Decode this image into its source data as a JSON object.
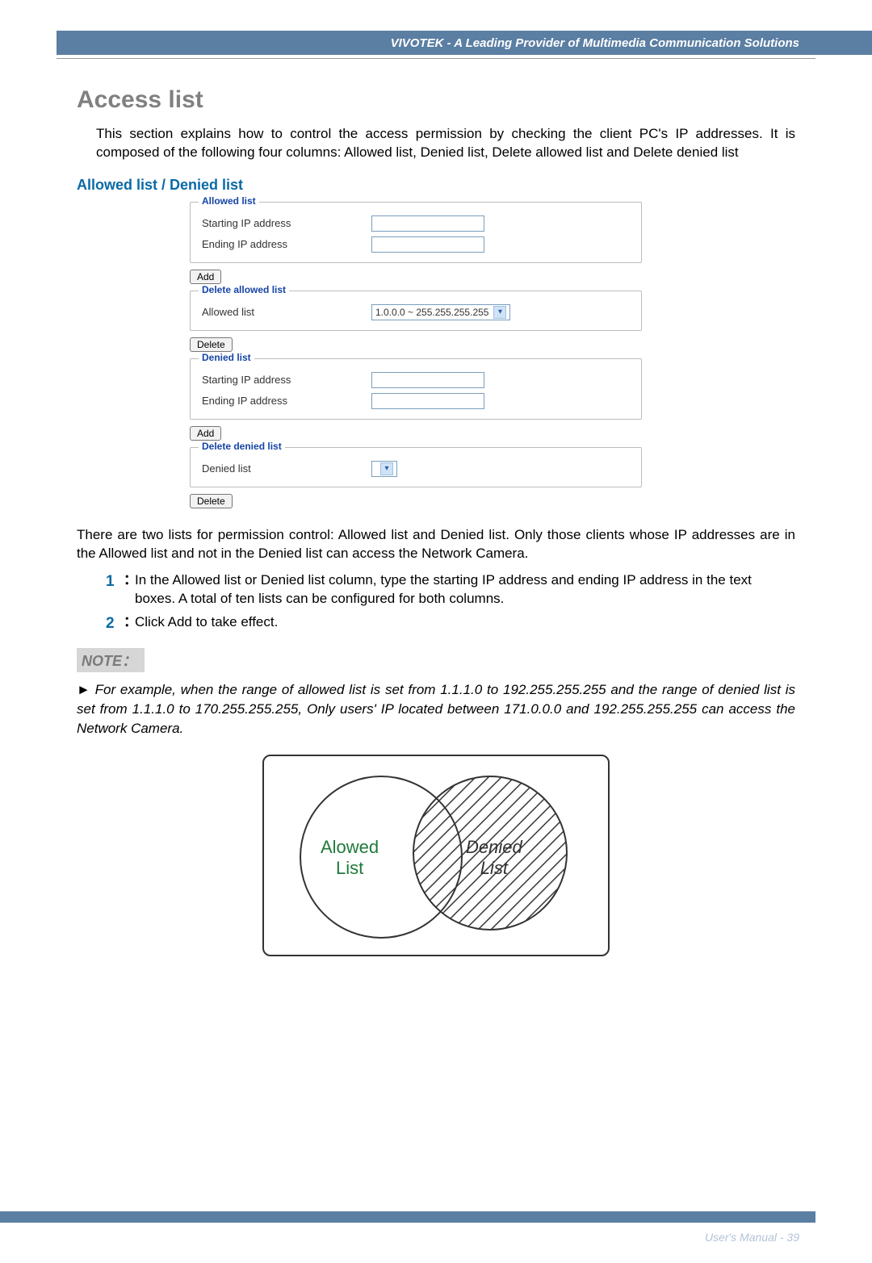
{
  "header": {
    "banner": "VIVOTEK - A Leading Provider of Multimedia Communication Solutions"
  },
  "title": "Access list",
  "intro": "This section explains how to control the access permission by checking the client PC's IP addresses. It is composed of the following four columns: Allowed list, Denied list, Delete allowed list and Delete denied list",
  "subhead": "Allowed list / Denied list",
  "form": {
    "allowed": {
      "legend": "Allowed list",
      "start_label": "Starting IP address",
      "end_label": "Ending IP address",
      "add_label": "Add"
    },
    "delete_allowed": {
      "legend": "Delete allowed list",
      "list_label": "Allowed list",
      "select_value": "1.0.0.0 ~ 255.255.255.255",
      "delete_label": "Delete"
    },
    "denied": {
      "legend": "Denied list",
      "start_label": "Starting IP address",
      "end_label": "Ending IP address",
      "add_label": "Add"
    },
    "delete_denied": {
      "legend": "Delete denied list",
      "list_label": "Denied list",
      "select_value": "",
      "delete_label": "Delete"
    }
  },
  "after_para": "There are two lists for permission control: Allowed list and Denied list. Only those clients whose IP addresses are in the Allowed list and not in the Denied list can access the Network Camera.",
  "steps": [
    "In the Allowed list or Denied list column, type the starting IP address and ending IP address in the text boxes.  A total of ten lists can be configured for both columns.",
    "Click Add to take effect."
  ],
  "note": {
    "label": "NOTE：",
    "body": "► For example, when the range of allowed list is set from 1.1.1.0 to 192.255.255.255 and the range of denied list is set from 1.1.1.0 to 170.255.255.255, Only users' IP located between 171.0.0.0 and 192.255.255.255 can access the Network Camera."
  },
  "diagram": {
    "allowed_label": "Alowed List",
    "denied_label": "Denied List"
  },
  "footer": "User's Manual - 39"
}
